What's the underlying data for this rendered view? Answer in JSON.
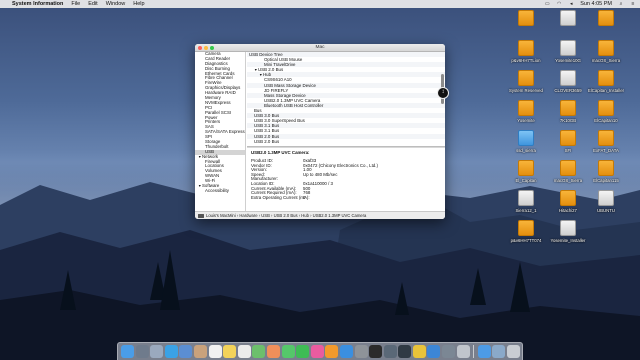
{
  "menubar": {
    "apple_glyph": "",
    "app_name": "System Information",
    "items": [
      "File",
      "Edit",
      "Window",
      "Help"
    ],
    "clock": "Sun 4:05 PM",
    "status_icons": [
      "mirror-icon",
      "wifi-icon",
      "volume-icon",
      "spotlight-icon",
      "notifications-icon"
    ]
  },
  "desktop_icons": [
    {
      "label": "",
      "kind": "drive-orange"
    },
    {
      "label": "",
      "kind": "drive-white"
    },
    {
      "label": "",
      "kind": "drive-orange"
    },
    {
      "label": "p&v6HH7TLion",
      "kind": "drive-orange"
    },
    {
      "label": "Yosemite10G",
      "kind": "drive-white"
    },
    {
      "label": "macOS_Sierra",
      "kind": "drive-orange"
    },
    {
      "label": "System Reserved",
      "kind": "drive-orange"
    },
    {
      "label": "CLOVER3659",
      "kind": "drive-white"
    },
    {
      "label": "ElCapitan_Installer",
      "kind": "drive-orange"
    },
    {
      "label": "Yosemite",
      "kind": "drive-orange"
    },
    {
      "label": "7K10GB",
      "kind": "drive-orange"
    },
    {
      "label": "ElCapitan10",
      "kind": "drive-orange"
    },
    {
      "label": "ssd_sierra",
      "kind": "folder-blue"
    },
    {
      "label": "SFI",
      "kind": "drive-orange"
    },
    {
      "label": "ExFAT_DATA",
      "kind": "drive-orange"
    },
    {
      "label": "El_Capitan",
      "kind": "drive-orange"
    },
    {
      "label": "macOS_Sierra",
      "kind": "drive-orange"
    },
    {
      "label": "ElCapitan115",
      "kind": "drive-orange"
    },
    {
      "label": "Sierra12_1",
      "kind": "drive-white"
    },
    {
      "label": "Hitachi27",
      "kind": "drive-orange"
    },
    {
      "label": "UBUNTU",
      "kind": "drive-white"
    },
    {
      "label": "p&v6HH7TT074",
      "kind": "drive-orange"
    },
    {
      "label": "Yosemite_Installer",
      "kind": "drive-white"
    }
  ],
  "window": {
    "title": "Mac",
    "sidebar": [
      {
        "label": "Camera",
        "group": false
      },
      {
        "label": "Card Reader",
        "group": false
      },
      {
        "label": "Diagnostics",
        "group": false
      },
      {
        "label": "Disc Burning",
        "group": false
      },
      {
        "label": "Ethernet Cards",
        "group": false
      },
      {
        "label": "Fibre Channel",
        "group": false
      },
      {
        "label": "FireWire",
        "group": false
      },
      {
        "label": "Graphics/Displays",
        "group": false
      },
      {
        "label": "Hardware RAID",
        "group": false
      },
      {
        "label": "Memory",
        "group": false
      },
      {
        "label": "NVMExpress",
        "group": false
      },
      {
        "label": "PCI",
        "group": false
      },
      {
        "label": "Parallel SCSI",
        "group": false
      },
      {
        "label": "Power",
        "group": false
      },
      {
        "label": "Printers",
        "group": false
      },
      {
        "label": "SAS",
        "group": false
      },
      {
        "label": "SATA/SATA Express",
        "group": false
      },
      {
        "label": "SPI",
        "group": false
      },
      {
        "label": "Storage",
        "group": false
      },
      {
        "label": "Thunderbolt",
        "group": false
      },
      {
        "label": "USB",
        "group": false,
        "selected": true
      },
      {
        "label": "Network",
        "group": true
      },
      {
        "label": "Firewall",
        "group": false
      },
      {
        "label": "Locations",
        "group": false
      },
      {
        "label": "Volumes",
        "group": false
      },
      {
        "label": "WWAN",
        "group": false
      },
      {
        "label": "Wi-Fi",
        "group": false
      },
      {
        "label": "Software",
        "group": true
      },
      {
        "label": "Accessibility",
        "group": false
      }
    ],
    "tree": [
      {
        "label": "USB Device Tree",
        "indent": 0,
        "arrow": ""
      },
      {
        "label": "Optical USB Mouse",
        "indent": 3,
        "arrow": ""
      },
      {
        "label": "Mini TravelDrive",
        "indent": 3,
        "arrow": ""
      },
      {
        "label": "USB 2.0 Bus",
        "indent": 1,
        "arrow": "▼"
      },
      {
        "label": "Hub",
        "indent": 2,
        "arrow": "▼"
      },
      {
        "label": "CS9S610 A10",
        "indent": 3,
        "arrow": ""
      },
      {
        "label": "USB Mass Storage Device",
        "indent": 3,
        "arrow": ""
      },
      {
        "label": "JD FIREFLY",
        "indent": 3,
        "arrow": ""
      },
      {
        "label": "Mass Storage Device",
        "indent": 3,
        "arrow": ""
      },
      {
        "label": "USB2.0 1.3MP UVC Camera",
        "indent": 3,
        "arrow": ""
      },
      {
        "label": "Bluetooth USB Host Controller",
        "indent": 3,
        "arrow": ""
      },
      {
        "label": "Bus",
        "indent": 1,
        "arrow": ""
      },
      {
        "label": "USB 3.0 Bus",
        "indent": 1,
        "arrow": ""
      },
      {
        "label": "USB 3.0 SuperSpeed Bus",
        "indent": 1,
        "arrow": ""
      },
      {
        "label": "USB 3.1 Bus",
        "indent": 1,
        "arrow": ""
      },
      {
        "label": "USB 3.1 Bus",
        "indent": 1,
        "arrow": ""
      },
      {
        "label": "USB 2.0 Bus",
        "indent": 1,
        "arrow": ""
      },
      {
        "label": "USB 2.0 Bus",
        "indent": 1,
        "arrow": ""
      }
    ],
    "detail": {
      "title": "USB2.0 1.3MP UVC Camera:",
      "rows": [
        {
          "k": "Product ID:",
          "v": "0xaf33"
        },
        {
          "k": "Vendor ID:",
          "v": "0x0472  (Chicony Electronics Co., Ltd.)"
        },
        {
          "k": "Version:",
          "v": "1.00"
        },
        {
          "k": "Speed:",
          "v": "Up to 480 Mb/sec"
        },
        {
          "k": "Manufacturer:",
          "v": ""
        },
        {
          "k": "Location ID:",
          "v": "0x1a110000 / 3"
        },
        {
          "k": "Current Available (mA):",
          "v": "500"
        },
        {
          "k": "Current Required (mA):",
          "v": "768"
        },
        {
          "k": "Extra Operating Current (mA):",
          "v": "0"
        }
      ]
    },
    "path": "Louis's MacMini › Hardware › USB › USB 2.0 Bus › Hub › USB2.0 1.3MP UVC Camera"
  },
  "dock": {
    "apps": [
      {
        "name": "finder-icon",
        "color": "#4a9de8"
      },
      {
        "name": "launchpad-icon",
        "color": "#6f7b8c"
      },
      {
        "name": "compass-icon",
        "color": "#9aa9be"
      },
      {
        "name": "safari-icon",
        "color": "#3aa2e6"
      },
      {
        "name": "mail-icon",
        "color": "#5b8ed2"
      },
      {
        "name": "contacts-icon",
        "color": "#c9a27c"
      },
      {
        "name": "calendar-icon",
        "color": "#f1f1f1"
      },
      {
        "name": "notes-icon",
        "color": "#f3d35a"
      },
      {
        "name": "reminders-icon",
        "color": "#ececec"
      },
      {
        "name": "maps-icon",
        "color": "#6cbf6c"
      },
      {
        "name": "photos-icon",
        "color": "#f08f5a"
      },
      {
        "name": "messages-icon",
        "color": "#55c76a"
      },
      {
        "name": "facetime-icon",
        "color": "#3ebc55"
      },
      {
        "name": "itunes-icon",
        "color": "#e95ca0"
      },
      {
        "name": "ibooks-icon",
        "color": "#f39a2c"
      },
      {
        "name": "appstore-icon",
        "color": "#3a8fe0"
      },
      {
        "name": "preferences-icon",
        "color": "#8e9399"
      },
      {
        "name": "terminal-icon",
        "color": "#2b2b2b"
      },
      {
        "name": "sysinfo-icon",
        "color": "#5a6877"
      },
      {
        "name": "activity-icon",
        "color": "#303a44"
      },
      {
        "name": "chrome-icon",
        "color": "#e9c33a"
      },
      {
        "name": "xcode-icon",
        "color": "#3c86d6"
      },
      {
        "name": "tool-icon",
        "color": "#7b8794"
      },
      {
        "name": "app-icon",
        "color": "#c0c5cc"
      }
    ],
    "right": [
      {
        "name": "downloads-icon",
        "color": "#4d9be6"
      },
      {
        "name": "folder-icon",
        "color": "#8aa9c9"
      },
      {
        "name": "trash-icon",
        "color": "#c9cdd3"
      }
    ]
  }
}
